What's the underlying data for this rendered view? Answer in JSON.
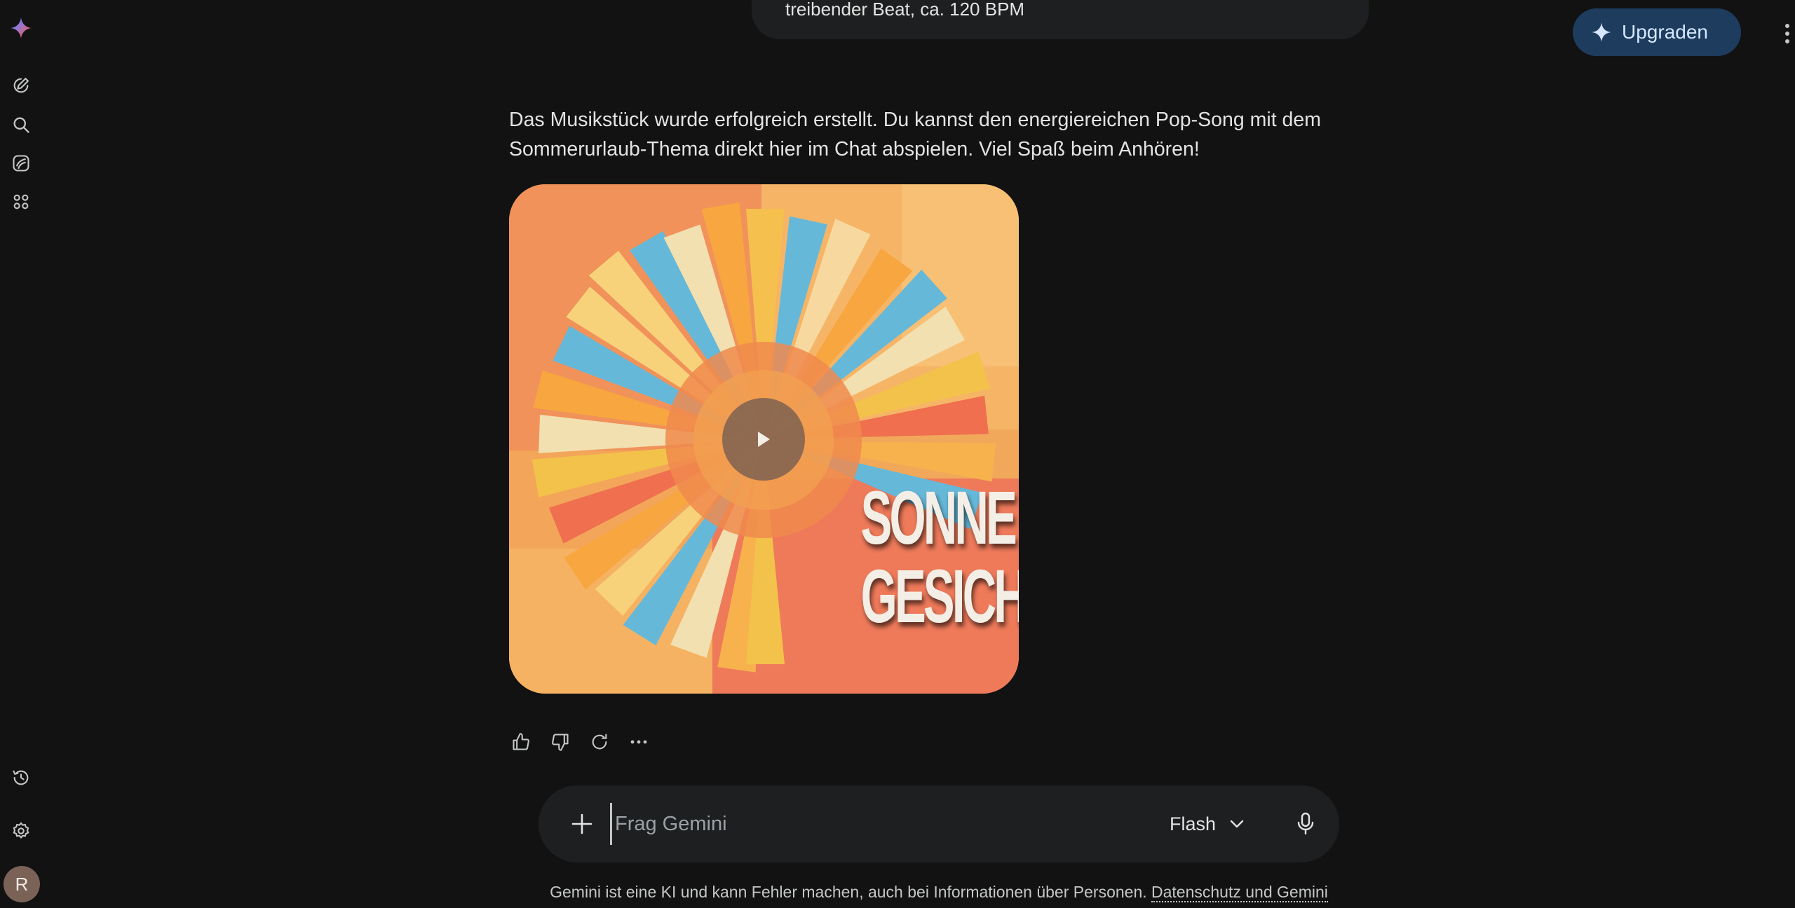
{
  "header": {
    "upgrade_label": "Upgraden"
  },
  "prompt": {
    "visible_text": "treibender Beat, ca. 120 BPM"
  },
  "response": {
    "text": "Das Musikstück wurde erfolgreich erstellt. Du kannst den energiereichen Pop-Song mit dem Sommerurlaub-Thema direkt hier im Chat abspielen. Viel Spaß beim Anhören!",
    "album": {
      "title_line1": "SONNE IM",
      "title_line2": "GESICHT"
    }
  },
  "composer": {
    "placeholder": "Frag Gemini",
    "model": "Flash"
  },
  "user": {
    "avatar_initial": "R"
  },
  "footer": {
    "disclaimer": "Gemini ist eine KI und kann Fehler machen, auch bei Informationen über Personen.",
    "link": "Datenschutz und Gemini"
  },
  "colors": {
    "background": "#121212",
    "surface": "#1e1f20",
    "upgrade_button": "#1d3c5e",
    "text": "#e3e3e3"
  },
  "icons": {
    "sidebar": [
      "gemini-logo-icon",
      "new-chat-icon",
      "search-icon",
      "gems-icon",
      "apps-icon",
      "activity-history-icon",
      "settings-icon"
    ],
    "actions": [
      "thumbs-up-icon",
      "thumbs-down-icon",
      "regenerate-icon",
      "more-horiz-icon"
    ]
  }
}
